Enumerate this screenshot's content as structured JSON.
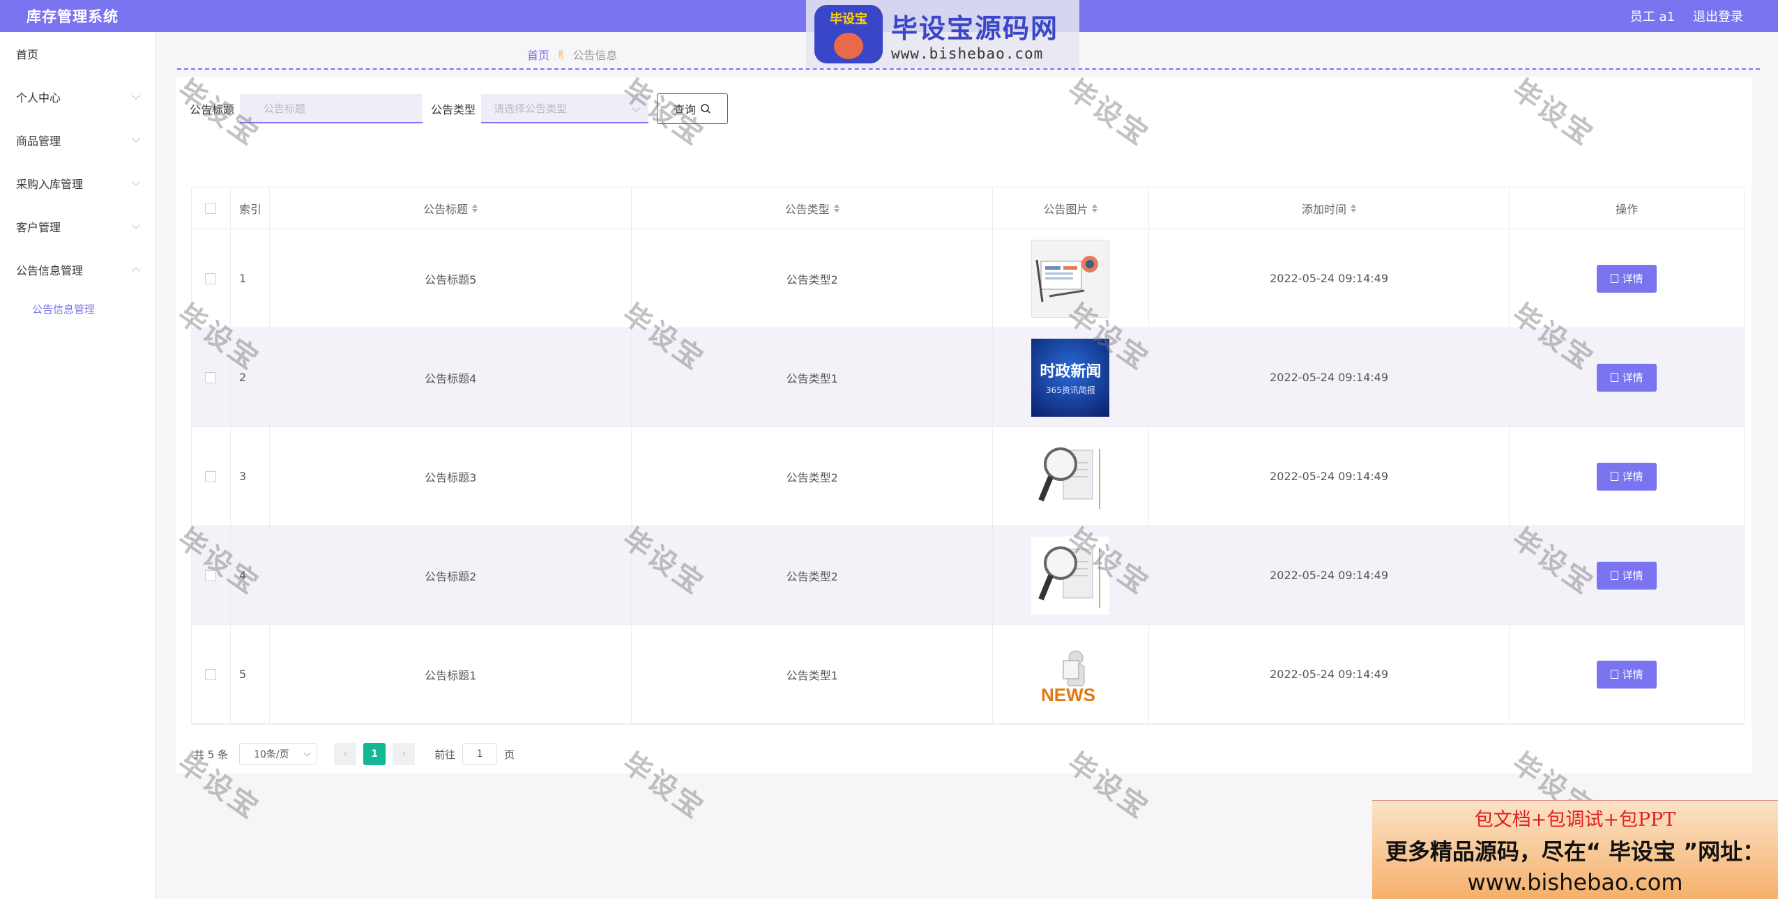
{
  "app": {
    "title": "库存管理系统",
    "user": "员工 a1",
    "logout": "退出登录"
  },
  "sidebar": {
    "items": [
      {
        "label": "首页",
        "has_children": false
      },
      {
        "label": "个人中心",
        "has_children": true
      },
      {
        "label": "商品管理",
        "has_children": true
      },
      {
        "label": "采购入库管理",
        "has_children": true
      },
      {
        "label": "客户管理",
        "has_children": true
      },
      {
        "label": "公告信息管理",
        "has_children": true,
        "expanded": true
      }
    ],
    "active_sub": "公告信息管理"
  },
  "breadcrumb": {
    "home": "首页",
    "current": "公告信息"
  },
  "search": {
    "title_label": "公告标题",
    "title_placeholder": "公告标题",
    "type_label": "公告类型",
    "type_placeholder": "请选择公告类型",
    "query_button": "查询"
  },
  "table": {
    "headers": {
      "index": "索引",
      "title": "公告标题",
      "type": "公告类型",
      "image": "公告图片",
      "time": "添加时间",
      "op": "操作"
    },
    "rows": [
      {
        "index": "1",
        "title": "公告标题5",
        "type": "公告类型2",
        "image": "news-laptop-icon",
        "time": "2022-05-24 09:14:49",
        "op": "详情"
      },
      {
        "index": "2",
        "title": "公告标题4",
        "type": "公告类型1",
        "image": "news-banner",
        "image_text": "时政新闻",
        "image_sub": "365资讯简报",
        "time": "2022-05-24 09:14:49",
        "op": "详情"
      },
      {
        "index": "3",
        "title": "公告标题3",
        "type": "公告类型2",
        "image": "news-magnifier",
        "time": "2022-05-24 09:14:49",
        "op": "详情"
      },
      {
        "index": "4",
        "title": "公告标题2",
        "type": "公告类型2",
        "image": "news-magnifier",
        "time": "2022-05-24 09:14:49",
        "op": "详情"
      },
      {
        "index": "5",
        "title": "公告标题1",
        "type": "公告类型1",
        "image": "news-figure",
        "time": "2022-05-24 09:14:49",
        "op": "详情"
      }
    ]
  },
  "pagination": {
    "total": "共 5 条",
    "page_size": "10条/页",
    "current": "1",
    "goto_prefix": "前往",
    "goto_value": "1",
    "goto_suffix": "页"
  },
  "watermark": {
    "text": "毕设宝",
    "logo_big": "毕设宝源码网",
    "logo_small": "www.bishebao.com",
    "badge": "毕设宝"
  },
  "ad": {
    "line1": "包文档+包调试+包PPT",
    "line2": "更多精品源码，尽在“ 毕设宝 ”网址：",
    "line3": "www.bishebao.com"
  },
  "colors": {
    "primary": "#7b74f0",
    "pager_active": "#11b894"
  }
}
